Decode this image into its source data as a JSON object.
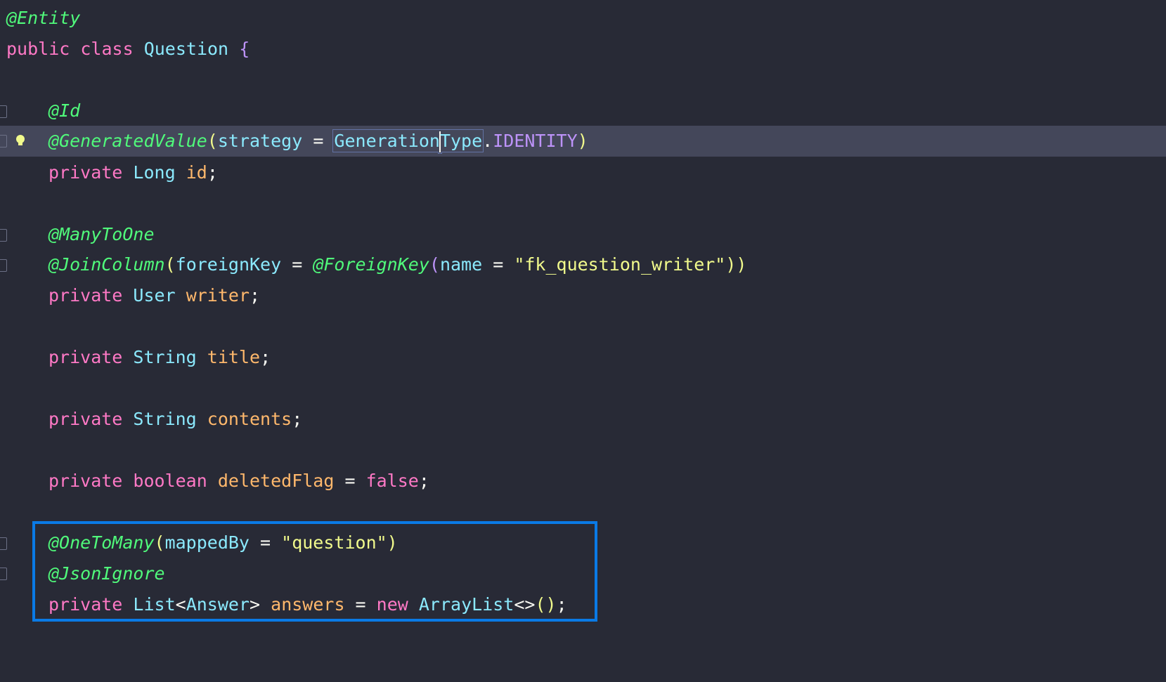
{
  "editor": {
    "language": "java",
    "highlight_color": "#0a7ae6",
    "lines": {
      "l1": {
        "ann": "@Entity"
      },
      "l2": {
        "kw1": "public",
        "kw2": "class",
        "name": "Question",
        "brace": "{"
      },
      "l4": {
        "ann": "@Id"
      },
      "l5": {
        "ann": "@GeneratedValue",
        "open": "(",
        "param": "strategy",
        "eq": " = ",
        "type_a": "Generation",
        "type_b": "Type",
        "dot": ".",
        "const": "IDENTITY",
        "close": ")"
      },
      "l6": {
        "kw": "private",
        "type": "Long",
        "field": "id",
        "semi": ";"
      },
      "l8": {
        "ann": "@ManyToOne"
      },
      "l9": {
        "ann": "@JoinColumn",
        "open": "(",
        "param": "foreignKey",
        "eq": " = ",
        "ann2": "@ForeignKey",
        "open2": "(",
        "param2": "name",
        "eq2": " = ",
        "str": "\"fk_question_writer\"",
        "close": "))"
      },
      "l10": {
        "kw": "private",
        "type": "User",
        "field": "writer",
        "semi": ";"
      },
      "l12": {
        "kw": "private",
        "type": "String",
        "field": "title",
        "semi": ";"
      },
      "l14": {
        "kw": "private",
        "type": "String",
        "field": "contents",
        "semi": ";"
      },
      "l16": {
        "kw": "private",
        "kw2": "boolean",
        "field": "deletedFlag",
        "eq": " = ",
        "val": "false",
        "semi": ";"
      },
      "l18": {
        "ann": "@OneToMany",
        "open": "(",
        "param": "mappedBy",
        "eq": " = ",
        "str": "\"question\"",
        "close": ")"
      },
      "l19": {
        "ann": "@JsonIgnore"
      },
      "l20": {
        "kw": "private",
        "type": "List",
        "lt": "<",
        "generic": "Answer",
        "gt": ">",
        "field": "answers",
        "eq": " = ",
        "kw2": "new",
        "type2": "ArrayList",
        "diamond": "<>",
        "call": "()",
        "semi": ";"
      }
    }
  }
}
